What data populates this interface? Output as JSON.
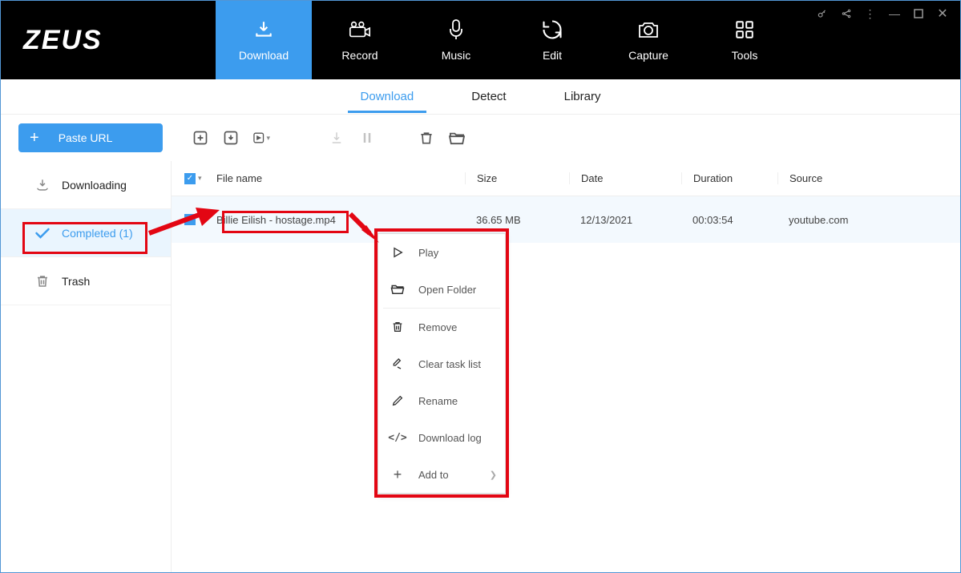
{
  "app": {
    "title": "ZEUS"
  },
  "nav": [
    {
      "label": "Download"
    },
    {
      "label": "Record"
    },
    {
      "label": "Music"
    },
    {
      "label": "Edit"
    },
    {
      "label": "Capture"
    },
    {
      "label": "Tools"
    }
  ],
  "subtabs": [
    {
      "label": "Download"
    },
    {
      "label": "Detect"
    },
    {
      "label": "Library"
    }
  ],
  "toolbar": {
    "paste_label": "Paste URL"
  },
  "sidebar": [
    {
      "label": "Downloading"
    },
    {
      "label": "Completed (1)"
    },
    {
      "label": "Trash"
    }
  ],
  "table": {
    "headers": {
      "filename": "File name",
      "size": "Size",
      "date": "Date",
      "duration": "Duration",
      "source": "Source"
    },
    "rows": [
      {
        "filename": "Billie Eilish - hostage.mp4",
        "size": "36.65 MB",
        "date": "12/13/2021",
        "duration": "00:03:54",
        "source": "youtube.com"
      }
    ]
  },
  "context_menu": [
    {
      "label": "Play"
    },
    {
      "label": "Open Folder"
    },
    {
      "label": "Remove"
    },
    {
      "label": "Clear task list"
    },
    {
      "label": "Rename"
    },
    {
      "label": "Download log"
    },
    {
      "label": "Add to"
    }
  ]
}
